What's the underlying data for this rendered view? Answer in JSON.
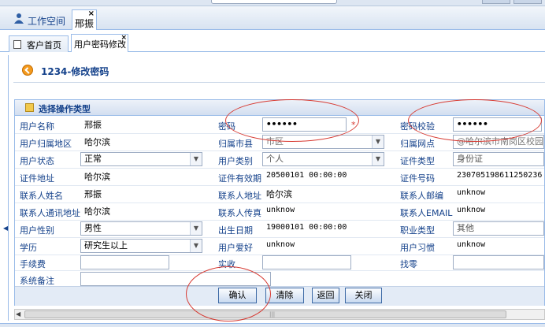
{
  "tabs": {
    "workspace_label": "工作空间",
    "main_tab_label": "邢振",
    "close_glyph": "×"
  },
  "subtabs": {
    "home_label": "客户首页",
    "pwd_label": "用户密码修改",
    "close_glyph": "×"
  },
  "page": {
    "title": "1234-修改密码",
    "section_title": "选择操作类型"
  },
  "form": {
    "user_name_label": "用户名称",
    "user_name": "邢振",
    "user_region_label": "用户归属地区",
    "user_region": "哈尔滨",
    "user_status_label": "用户状态",
    "user_status": "正常",
    "cert_addr_label": "证件地址",
    "cert_addr": "哈尔滨",
    "contact_name_label": "联系人姓名",
    "contact_name": "邢振",
    "contact_comm_label": "联系人通讯地址",
    "contact_comm": "哈尔滨",
    "gender_label": "用户性别",
    "gender": "男性",
    "education_label": "学历",
    "education": "研究生以上",
    "fee_label": "手续费",
    "fee": "",
    "remark_label": "系统备注",
    "remark": "",
    "password_label": "密码",
    "password": "••••••",
    "city_label": "归属市县",
    "city": "市区",
    "user_type_label": "用户类别",
    "user_type": "个人",
    "cert_valid_label": "证件有效期",
    "cert_valid": "20500101 00:00:00",
    "contact_addr_label": "联系人地址",
    "contact_addr": "哈尔滨",
    "contact_fax_label": "联系人传真",
    "contact_fax": "unknow",
    "birth_label": "出生日期",
    "birth": "19000101 00:00:00",
    "hobby_label": "用户爱好",
    "hobby": "unknow",
    "received_label": "实收",
    "received": "",
    "pwd_check_label": "密码校验",
    "pwd_check": "••••••",
    "outlet_label": "归属网点",
    "outlet": "@哈尔滨市南岗区校园通",
    "cert_type_label": "证件类型",
    "cert_type": "身份证",
    "cert_no_label": "证件号码",
    "cert_no": "230705198611250236",
    "contact_zip_label": "联系人邮编",
    "contact_zip": "unknow",
    "contact_email_label": "联系人EMAIL",
    "contact_email": "unknow",
    "job_label": "职业类型",
    "job": "其他",
    "habit_label": "用户习惯",
    "habit": "unknow",
    "change_label": "找零",
    "change": "",
    "required_mark": "*"
  },
  "buttons": {
    "confirm": "确认",
    "clear": "清除",
    "back": "返回",
    "close": "关闭"
  },
  "scroll_arrow": "◀",
  "dropdown_arrow": "▼",
  "colors": {
    "label": "#15428b",
    "annotation_circle": "#d73a32",
    "border": "#99bbe8"
  }
}
